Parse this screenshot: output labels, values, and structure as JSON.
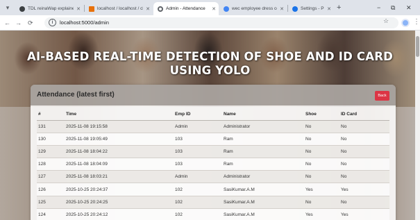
{
  "browser": {
    "tabs": [
      {
        "title": "TDL reinaWap explained",
        "favicon_color": "#3c4043",
        "active": false
      },
      {
        "title": "localhost / localhost / cl",
        "favicon_color": "#e8710a",
        "active": false
      },
      {
        "title": "Admin - Attendance",
        "favicon_color": "#5f6368",
        "active": true
      },
      {
        "title": "wec employee dress cod",
        "favicon_color": "#4285f4",
        "active": false
      },
      {
        "title": "Settings - Privacy and se",
        "favicon_color": "#1a73e8",
        "active": false
      }
    ],
    "new_tab_icon": "+",
    "window_controls": {
      "minimize": "−",
      "restore": "⧉",
      "close": "✕"
    },
    "address": "localhost:5000/admin",
    "nav_icons": {
      "back": "←",
      "forward": "→",
      "reload": "⟳"
    }
  },
  "page": {
    "hero_title": "AI-BASED REAL-TIME DETECTION OF SHOE AND ID CARD USING YOLO",
    "card_title": "Attendance (latest first)",
    "back_button": "Back",
    "table": {
      "headers": [
        "#",
        "Time",
        "Emp ID",
        "Name",
        "Shoe",
        "ID Card"
      ],
      "rows": [
        {
          "id": "131",
          "time": "2025-11-08 19:15:58",
          "emp_id": "Admin",
          "name": "Administrator",
          "shoe": "No",
          "id_card": "No"
        },
        {
          "id": "130",
          "time": "2025-11-08 19:05:49",
          "emp_id": "103",
          "name": "Ram",
          "shoe": "No",
          "id_card": "No"
        },
        {
          "id": "129",
          "time": "2025-11-08 18:04:22",
          "emp_id": "103",
          "name": "Ram",
          "shoe": "No",
          "id_card": "No"
        },
        {
          "id": "128",
          "time": "2025-11-08 18:04:09",
          "emp_id": "103",
          "name": "Ram",
          "shoe": "No",
          "id_card": "No"
        },
        {
          "id": "127",
          "time": "2025-11-08 18:03:21",
          "emp_id": "Admin",
          "name": "Administrator",
          "shoe": "No",
          "id_card": "No"
        },
        {
          "id": "126",
          "time": "2025-10-25 20:24:37",
          "emp_id": "102",
          "name": "SasiKumar.A.M",
          "shoe": "Yes",
          "id_card": "Yes"
        },
        {
          "id": "125",
          "time": "2025-10-25 20:24:25",
          "emp_id": "102",
          "name": "SasiKumar.A.M",
          "shoe": "No",
          "id_card": "No"
        },
        {
          "id": "124",
          "time": "2025-10-25 20:24:12",
          "emp_id": "102",
          "name": "SasiKumar.A.M",
          "shoe": "Yes",
          "id_card": "Yes"
        }
      ]
    }
  },
  "colors": {
    "back_button": "#dc3545",
    "tab_strip": "#dfe3ea"
  }
}
